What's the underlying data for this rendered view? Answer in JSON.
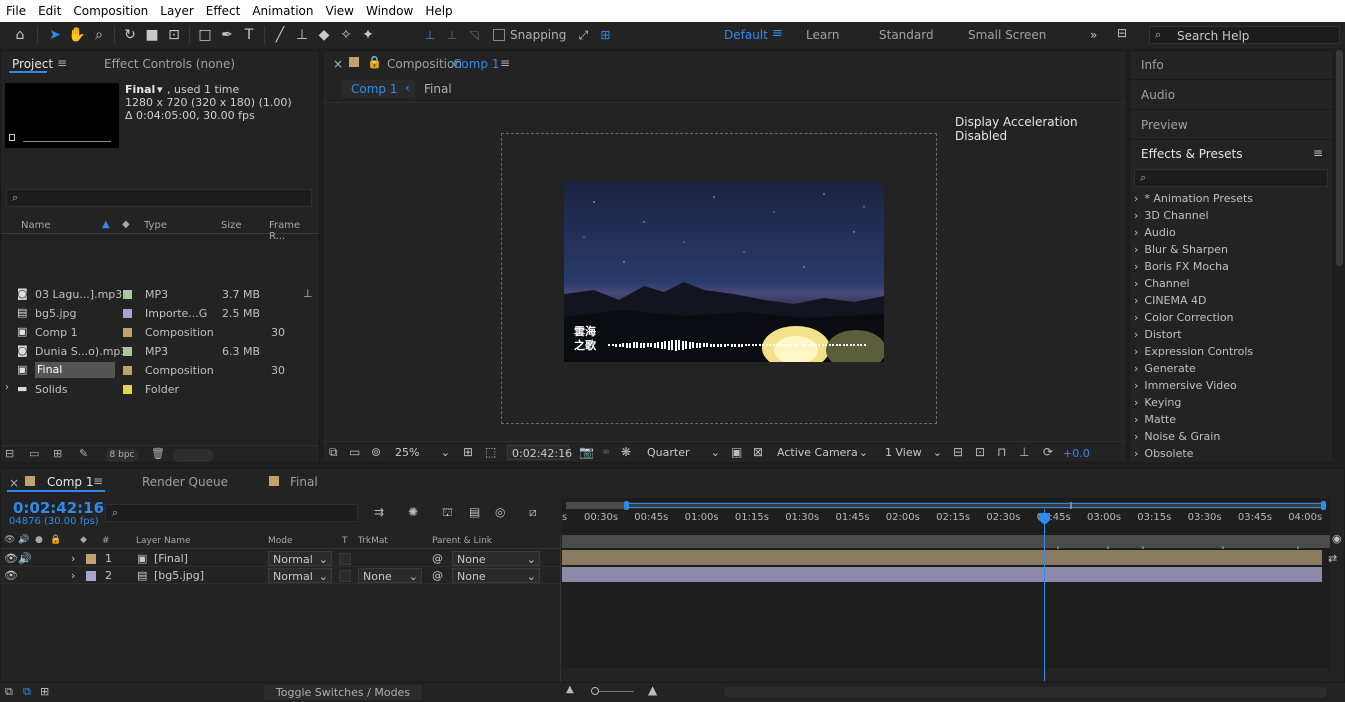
{
  "menu": [
    "File",
    "Edit",
    "Composition",
    "Layer",
    "Effect",
    "Animation",
    "View",
    "Window",
    "Help"
  ],
  "toolbar": {
    "snapping_label": "Snapping",
    "workspaces": [
      "Default",
      "Learn",
      "Standard",
      "Small Screen"
    ],
    "search_placeholder": "Search Help"
  },
  "project": {
    "tab": "Project",
    "tab2": "Effect Controls (none)",
    "item_name": "Final",
    "item_used": ", used 1 time",
    "item_res": "1280 x 720  (320 x 180) (1.00)",
    "item_dur": "Δ 0:04:05:00, 30.00 fps",
    "columns": {
      "name": "Name",
      "type": "Type",
      "size": "Size",
      "frame": "Frame R..."
    },
    "rows": [
      {
        "name": "03  Lagu...].mp3",
        "type": "MP3",
        "size": "3.7 MB",
        "frame": "",
        "color": "#a8c9a0"
      },
      {
        "name": "bg5.jpg",
        "type": "Importe...G",
        "size": "2.5 MB",
        "frame": "",
        "color": "#a9a4cf"
      },
      {
        "name": "Comp 1",
        "type": "Composition",
        "size": "",
        "frame": "30",
        "color": "#c3a16a"
      },
      {
        "name": "Dunia S...o).mp3",
        "type": "MP3",
        "size": "6.3 MB",
        "frame": "",
        "color": "#a8c9a0"
      },
      {
        "name": "Final",
        "type": "Composition",
        "size": "",
        "frame": "30",
        "color": "#c3a16a"
      },
      {
        "name": "Solids",
        "type": "Folder",
        "size": "",
        "frame": "",
        "color": "#e5d54a"
      }
    ],
    "bpc": "8 bpc"
  },
  "composition": {
    "tab_prefix": "Composition",
    "tab_name": "Comp 1",
    "crumb1": "Comp 1",
    "crumb2": "Final",
    "notice": "Display Acceleration Disabled",
    "title_line1": "雲海",
    "title_line2": "之歌",
    "zoom": "25%",
    "timecode": "0:02:42:16",
    "resolution": "Quarter",
    "camera": "Active Camera",
    "views": "1 View",
    "exposure": "+0.0"
  },
  "right": {
    "panels": [
      "Info",
      "Audio",
      "Preview"
    ],
    "effects_title": "Effects & Presets",
    "effects": [
      "* Animation Presets",
      "3D Channel",
      "Audio",
      "Blur & Sharpen",
      "Boris FX Mocha",
      "Channel",
      "CINEMA 4D",
      "Color Correction",
      "Distort",
      "Expression Controls",
      "Generate",
      "Immersive Video",
      "Keying",
      "Matte",
      "Noise & Grain",
      "Obsolete"
    ]
  },
  "timeline": {
    "tab_comp": "Comp 1",
    "tab_render": "Render Queue",
    "tab_final": "Final",
    "timecode": "0:02:42:16",
    "frames": "04876 (30.00 fps)",
    "headers": {
      "num": "#",
      "layer": "Layer Name",
      "mode": "Mode",
      "t": "T",
      "trk": "TrkMat",
      "parent": "Parent & Link"
    },
    "layers": [
      {
        "num": "1",
        "name": "[Final]",
        "mode": "Normal",
        "trk": "",
        "parent": "None",
        "color": "#c3a16a"
      },
      {
        "num": "2",
        "name": "[bg5.jpg]",
        "mode": "Normal",
        "trk": "None",
        "parent": "None",
        "color": "#a9a4cf"
      }
    ],
    "ruler": [
      "s",
      "00:30s",
      "00:45s",
      "01:00s",
      "01:15s",
      "01:30s",
      "01:45s",
      "02:00s",
      "02:15s",
      "02:30s",
      "02:45s",
      "03:00s",
      "03:15s",
      "03:30s",
      "03:45s",
      "04:00s"
    ],
    "footer_toggle": "Toggle Switches / Modes"
  }
}
